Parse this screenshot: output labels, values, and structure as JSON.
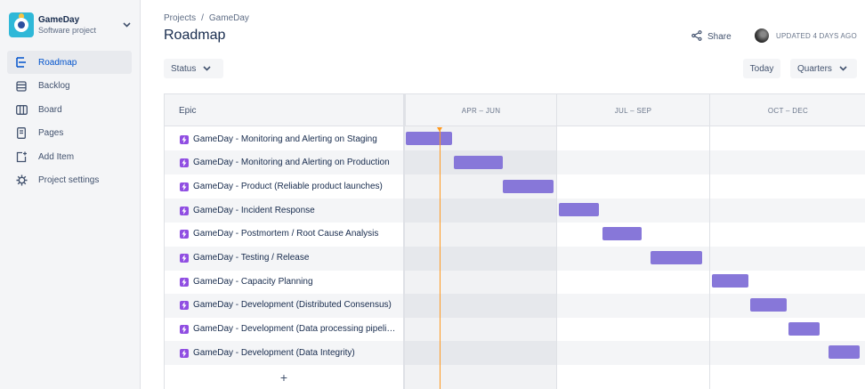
{
  "project": {
    "name": "GameDay",
    "type": "Software project"
  },
  "sidebar": {
    "items": [
      {
        "label": "Roadmap",
        "icon": "roadmap-icon",
        "active": true
      },
      {
        "label": "Backlog",
        "icon": "backlog-icon",
        "active": false
      },
      {
        "label": "Board",
        "icon": "board-icon",
        "active": false
      },
      {
        "label": "Pages",
        "icon": "pages-icon",
        "active": false
      },
      {
        "label": "Add Item",
        "icon": "add-item-icon",
        "active": false
      },
      {
        "label": "Project settings",
        "icon": "gear-icon",
        "active": false
      }
    ]
  },
  "breadcrumbs": {
    "root": "Projects",
    "separator": "/",
    "current": "GameDay"
  },
  "page": {
    "title": "Roadmap"
  },
  "header": {
    "share_label": "Share",
    "updated_label": "UPDATED 4 DAYS AGO"
  },
  "toolbar": {
    "status_label": "Status",
    "today_label": "Today",
    "quarters_label": "Quarters"
  },
  "roadmap": {
    "epic_header": "Epic",
    "quarters": [
      "APR – JUN",
      "JUL – SEP",
      "OCT – DEC"
    ],
    "epics": [
      "GameDay - Monitoring and Alerting on Staging",
      "GameDay - Monitoring and Alerting on Production",
      "GameDay - Product (Reliable product launches)",
      "GameDay - Incident Response",
      "GameDay - Postmortem / Root Cause Analysis",
      "GameDay - Testing / Release",
      "GameDay - Capacity Planning",
      "GameDay - Development (Distributed Consensus)",
      "GameDay - Development (Data processing pipelines)",
      "GameDay - Development (Data Integrity)"
    ],
    "add_label": "+"
  },
  "colors": {
    "accent": "#0052CC",
    "bar": "#8777D9",
    "epic_icon": "#904EE2",
    "today_line": "#FF991F"
  }
}
